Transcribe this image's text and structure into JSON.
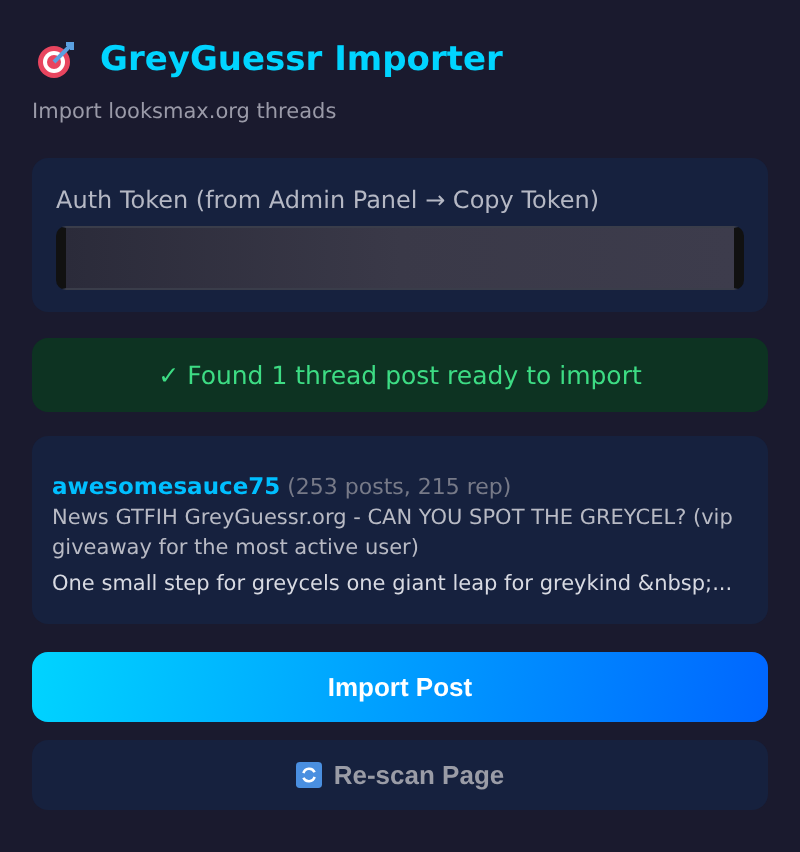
{
  "header": {
    "title": "GreyGuessr Importer",
    "subtitle": "Import looksmax.org threads"
  },
  "token": {
    "label": "Auth Token (from Admin Panel → Copy Token)"
  },
  "status": {
    "kind": "success",
    "message": "✓ Found 1 thread post ready to import"
  },
  "post": {
    "author": "awesomesauce75",
    "stats": "(253 posts, 215 rep)",
    "title": "News GTFIH GreyGuessr.org - CAN YOU SPOT THE GREYCEL? (vip giveaway for the most active user)",
    "excerpt": "One small step for greycels one giant leap for greykind &nbsp;..."
  },
  "buttons": [
    {
      "kind": "primary",
      "label": "Import Post"
    },
    {
      "kind": "secondary",
      "label": "Re-scan Page"
    }
  ]
}
